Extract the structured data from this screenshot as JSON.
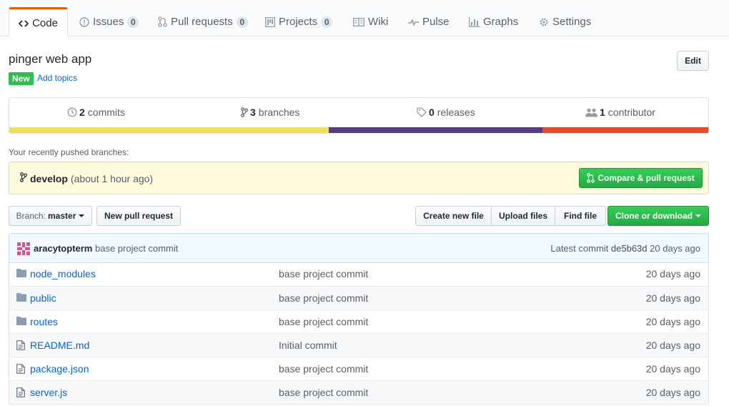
{
  "nav": {
    "tabs": [
      {
        "label": "Code",
        "icon": "code-icon"
      },
      {
        "label": "Issues",
        "count": "0",
        "icon": "issue-icon"
      },
      {
        "label": "Pull requests",
        "count": "0",
        "icon": "pull-request-icon"
      },
      {
        "label": "Projects",
        "count": "0",
        "icon": "project-icon"
      },
      {
        "label": "Wiki",
        "icon": "book-icon"
      },
      {
        "label": "Pulse",
        "icon": "pulse-icon"
      },
      {
        "label": "Graphs",
        "icon": "graph-icon"
      },
      {
        "label": "Settings",
        "icon": "gear-icon"
      }
    ]
  },
  "repo": {
    "description": "pinger web app",
    "new_badge": "New",
    "add_topics": "Add topics",
    "edit_label": "Edit"
  },
  "summary": {
    "commits": {
      "count": "2",
      "label": "commits"
    },
    "branches": {
      "count": "3",
      "label": "branches"
    },
    "releases": {
      "count": "0",
      "label": "releases"
    },
    "contributors": {
      "count": "1",
      "label": "contributor"
    },
    "languages": [
      {
        "color": "#f1e05a",
        "percent": 45.7
      },
      {
        "color": "#563d7c",
        "percent": 30.6
      },
      {
        "color": "#e34c26",
        "percent": 23.7
      }
    ]
  },
  "recent": {
    "label": "Your recently pushed branches:",
    "branch": "develop",
    "time": "(about 1 hour ago)",
    "compare_label": "Compare & pull request"
  },
  "file_nav": {
    "branch_prefix": "Branch:",
    "branch_name": "master",
    "new_pr": "New pull request",
    "create_file": "Create new file",
    "upload_files": "Upload files",
    "find_file": "Find file",
    "clone": "Clone or download"
  },
  "latest_commit": {
    "author": "aracytopterm",
    "message": "base project commit",
    "prefix": "Latest commit",
    "sha": "de5b63d",
    "age": "20 days ago"
  },
  "files": [
    {
      "name": "node_modules",
      "type": "dir",
      "message": "base project commit",
      "age": "20 days ago"
    },
    {
      "name": "public",
      "type": "dir",
      "message": "base project commit",
      "age": "20 days ago"
    },
    {
      "name": "routes",
      "type": "dir",
      "message": "base project commit",
      "age": "20 days ago"
    },
    {
      "name": "README.md",
      "type": "file",
      "message": "Initial commit",
      "age": "20 days ago"
    },
    {
      "name": "package.json",
      "type": "file",
      "message": "base project commit",
      "age": "20 days ago"
    },
    {
      "name": "server.js",
      "type": "file",
      "message": "base project commit",
      "age": "20 days ago"
    }
  ]
}
